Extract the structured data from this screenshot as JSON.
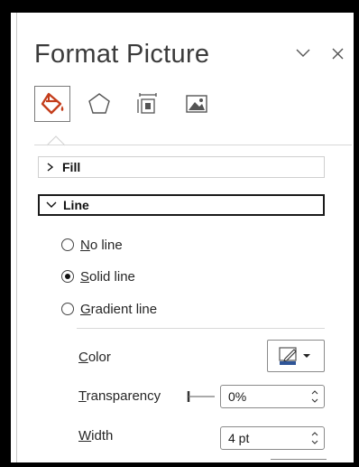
{
  "pane": {
    "title": "Format Picture",
    "header_icons": [
      "chevron-down-icon",
      "close-icon"
    ],
    "tabs": [
      {
        "name": "fill-line",
        "icon": "paint-bucket-icon",
        "selected": true
      },
      {
        "name": "effects",
        "icon": "pentagon-icon",
        "selected": false
      },
      {
        "name": "size-properties",
        "icon": "size-properties-icon",
        "selected": false
      },
      {
        "name": "picture",
        "icon": "picture-icon",
        "selected": false
      }
    ],
    "accent_color": "#c43e1c"
  },
  "sections": {
    "fill": {
      "label": "Fill",
      "expanded": false
    },
    "line": {
      "label": "Line",
      "expanded": true
    }
  },
  "line_options": [
    {
      "mnemonic": "N",
      "rest": "o line",
      "checked": false
    },
    {
      "mnemonic": "S",
      "rest": "olid line",
      "checked": true
    },
    {
      "mnemonic": "G",
      "rest": "radient line",
      "checked": false
    }
  ],
  "properties": {
    "color": {
      "mnemonic": "C",
      "rest": "olor",
      "swatch": "#2f5597"
    },
    "transparency": {
      "mnemonic": "T",
      "rest": "ransparency",
      "value": "0%"
    },
    "width": {
      "mnemonic": "W",
      "rest": "idth",
      "value": "4 pt"
    }
  }
}
